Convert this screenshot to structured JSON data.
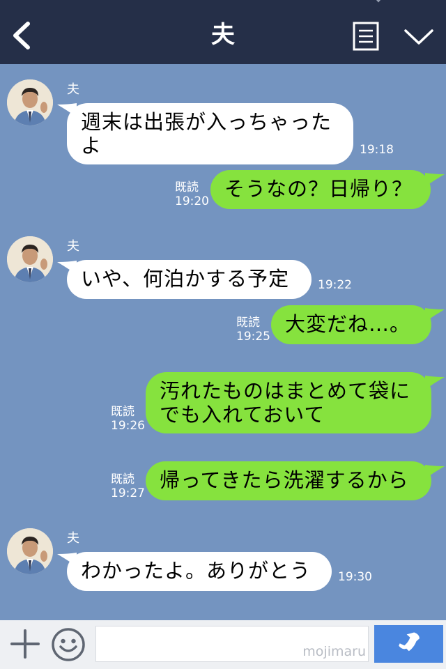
{
  "header": {
    "title": "夫",
    "back_icon": "chevron-left-icon",
    "notes_icon": "note-list-icon",
    "menu_icon": "chevron-down-icon"
  },
  "contact": {
    "name": "夫"
  },
  "messages": [
    {
      "side": "in",
      "sender": "夫",
      "text": "週末は出張が入っちゃったよ",
      "time": "19:18"
    },
    {
      "side": "out",
      "read": "既読",
      "text": "そうなの？日帰り？",
      "time": "19:20"
    },
    {
      "side": "in",
      "sender": "夫",
      "text": "いや、何泊かする予定",
      "time": "19:22"
    },
    {
      "side": "out",
      "read": "既読",
      "text": "大変だね…。",
      "time": "19:25"
    },
    {
      "side": "out",
      "read": "既読",
      "text": "汚れたものはまとめて袋にでも入れておいて",
      "time": "19:26"
    },
    {
      "side": "out",
      "read": "既読",
      "text": "帰ってきたら洗濯するから",
      "time": "19:27"
    },
    {
      "side": "in",
      "sender": "夫",
      "text": "わかったよ。ありがとう",
      "time": "19:30"
    }
  ],
  "bottom": {
    "input_value": "",
    "watermark": "mojimaru",
    "plus_icon": "plus-icon",
    "emoji_icon": "smiley-icon",
    "call_icon": "phone-icon"
  },
  "colors": {
    "header": "#252f48",
    "background": "#7494c0",
    "incoming_bubble": "#ffffff",
    "outgoing_bubble": "#86e23e",
    "call_button": "#4a86df"
  }
}
